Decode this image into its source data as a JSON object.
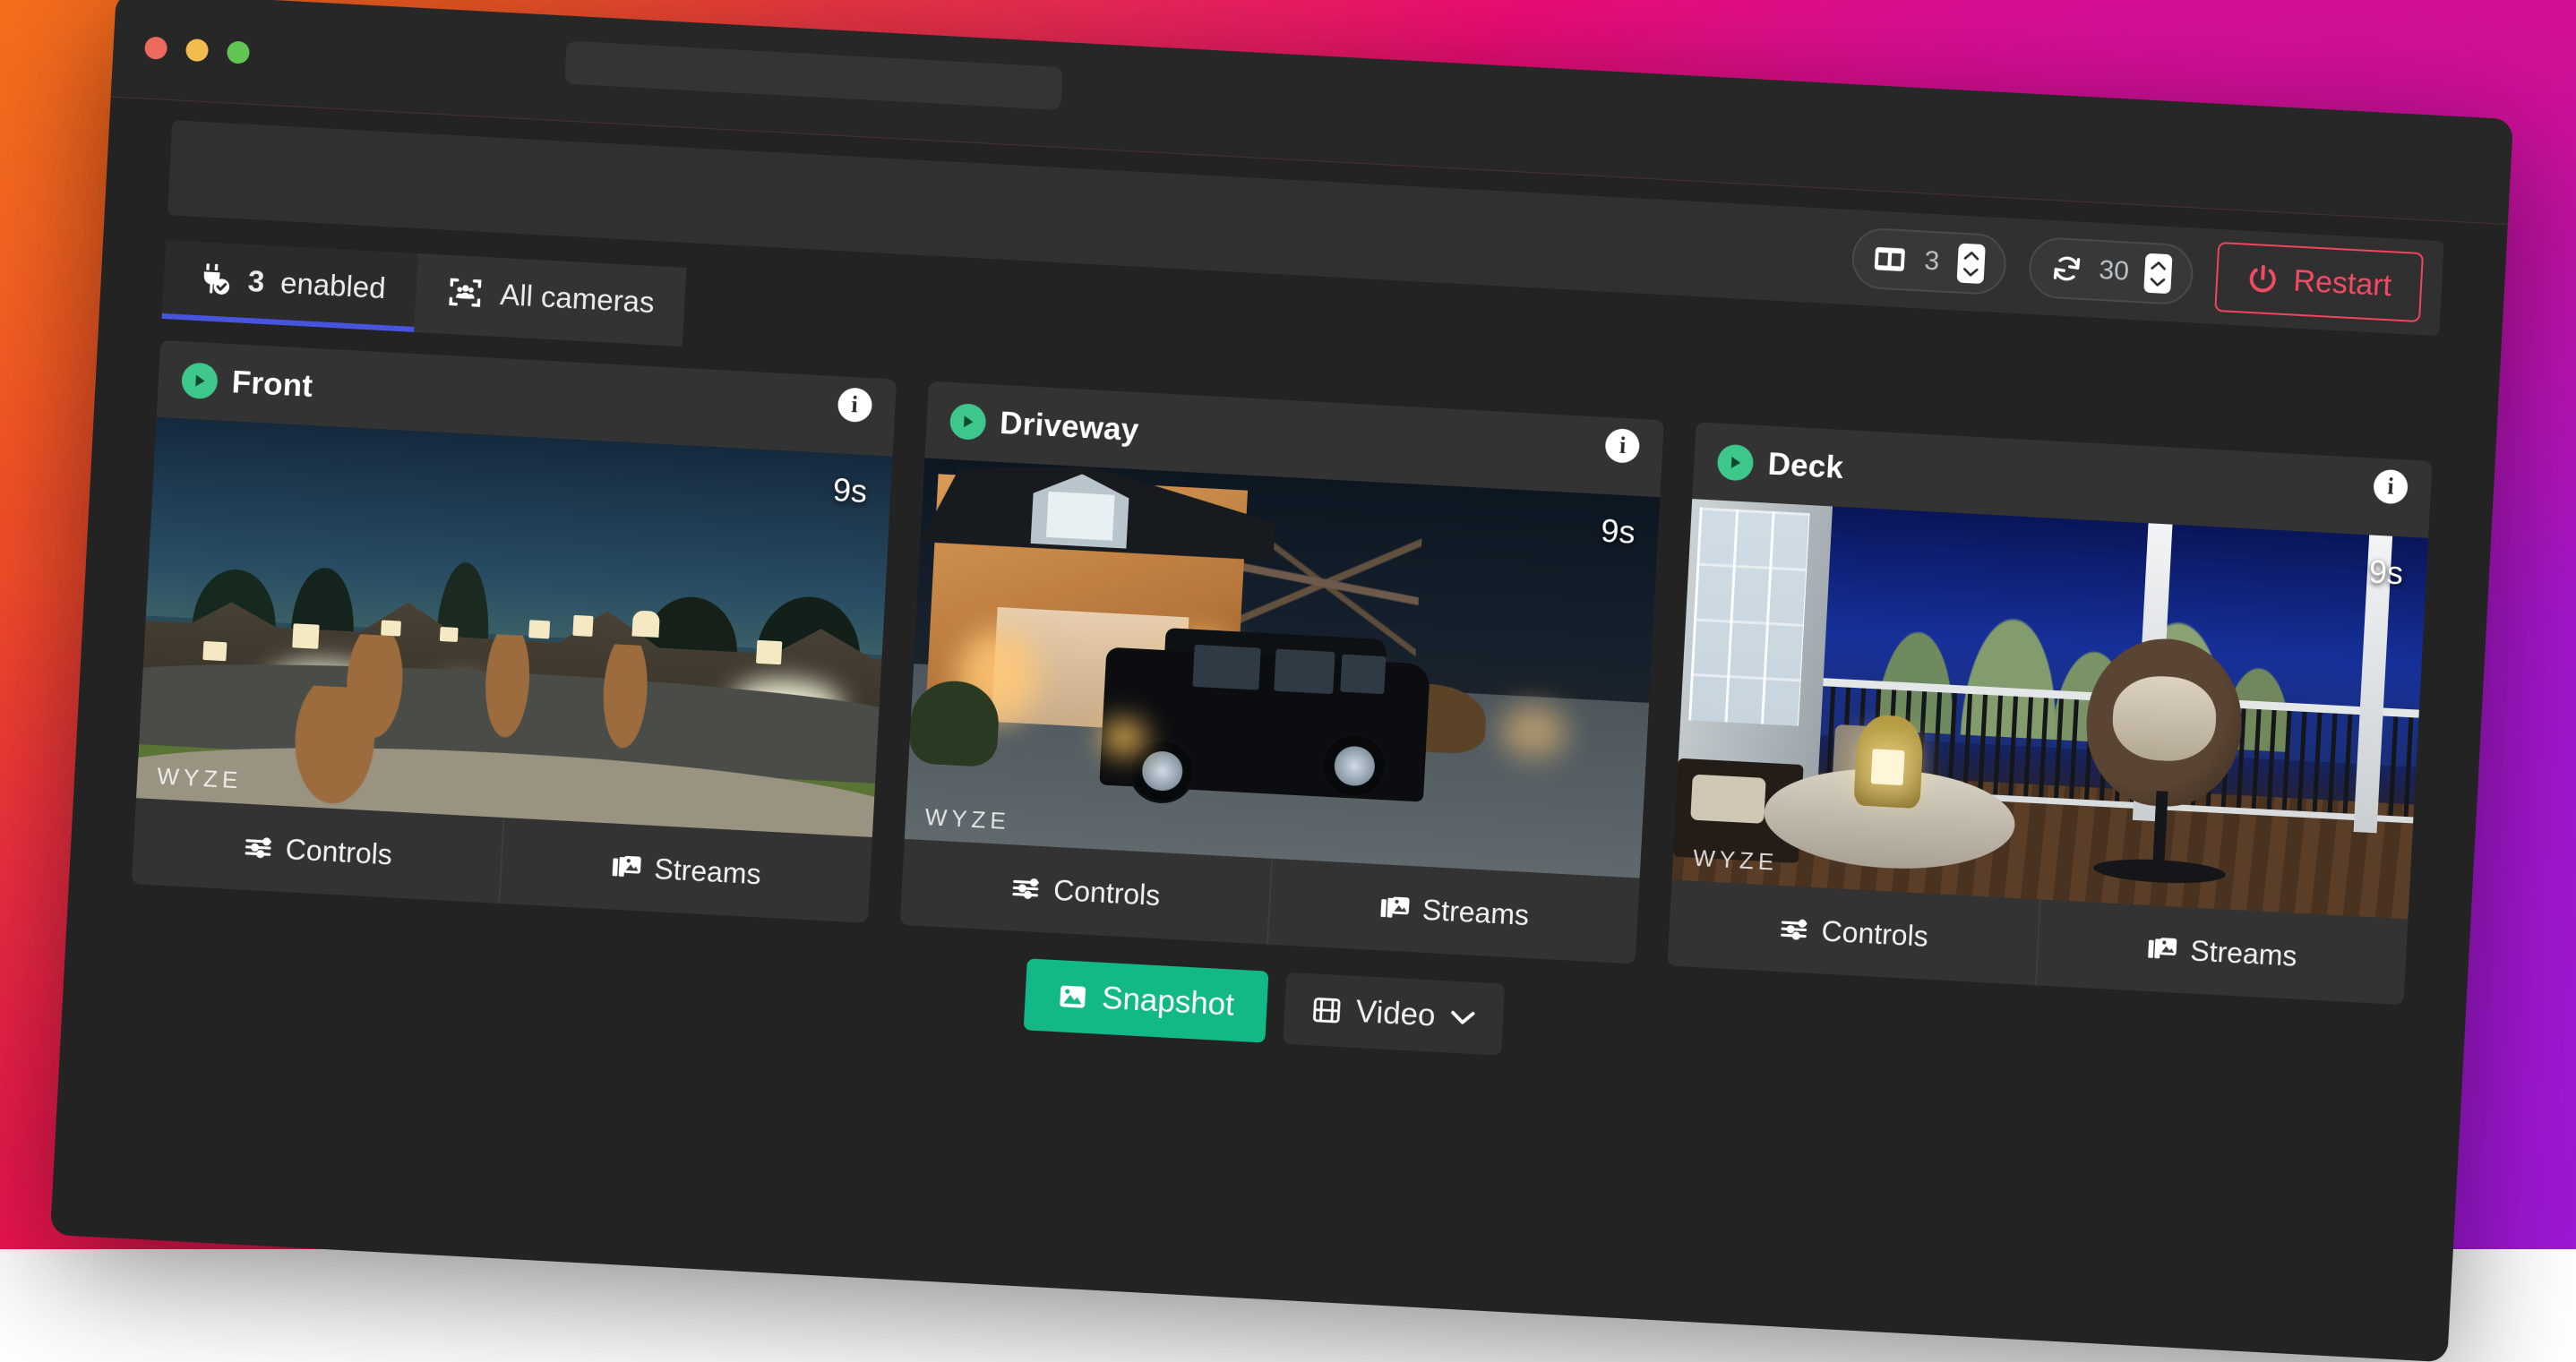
{
  "window": {
    "traffic_lights": [
      "close",
      "minimize",
      "zoom"
    ],
    "url_value": "",
    "url_placeholder": ""
  },
  "toolbar": {
    "columns_stepper": {
      "icon": "columns-icon",
      "value": "3"
    },
    "refresh_stepper": {
      "icon": "refresh-icon",
      "value": "30"
    },
    "restart_button": {
      "icon": "power-icon",
      "label": "Restart",
      "color": "#f24b64"
    }
  },
  "tabs": [
    {
      "id": "enabled",
      "icon": "plug-check-icon",
      "count": "3",
      "label": "enabled",
      "active": true,
      "accent": "#4754e0"
    },
    {
      "id": "all-cameras",
      "icon": "cameras-group-icon",
      "count": "",
      "label": "All cameras",
      "active": false
    }
  ],
  "cameras": [
    {
      "name": "Front",
      "status_icon": "play-circle-icon",
      "status_color": "#3ec78b",
      "info_icon": "info-icon",
      "timer": "9s",
      "watermark": "WYZE",
      "scene": "night suburban street with houses, bare trees, sidewalk",
      "controls_label": "Controls",
      "controls_icon": "sliders-icon",
      "streams_label": "Streams",
      "streams_icon": "images-icon"
    },
    {
      "name": "Driveway",
      "status_icon": "play-circle-icon",
      "status_color": "#3ec78b",
      "info_icon": "info-icon",
      "timer": "9s",
      "watermark": "WYZE",
      "scene": "night driveway with dark SUV in front of lit garage and bare tree",
      "controls_label": "Controls",
      "controls_icon": "sliders-icon",
      "streams_label": "Streams",
      "streams_icon": "images-icon"
    },
    {
      "name": "Deck",
      "status_icon": "play-circle-icon",
      "status_color": "#3ec78b",
      "info_icon": "info-icon",
      "timer": "9s",
      "watermark": "WYZE",
      "scene": "night deck with hanging egg chair, round table and lit lantern",
      "controls_label": "Controls",
      "controls_icon": "sliders-icon",
      "streams_label": "Streams",
      "streams_icon": "images-icon"
    }
  ],
  "actions": {
    "snapshot": {
      "label": "Snapshot",
      "icon": "image-icon",
      "color": "#12b886"
    },
    "video": {
      "label": "Video",
      "icon": "film-icon",
      "chevron": "chevron-down-icon"
    }
  }
}
